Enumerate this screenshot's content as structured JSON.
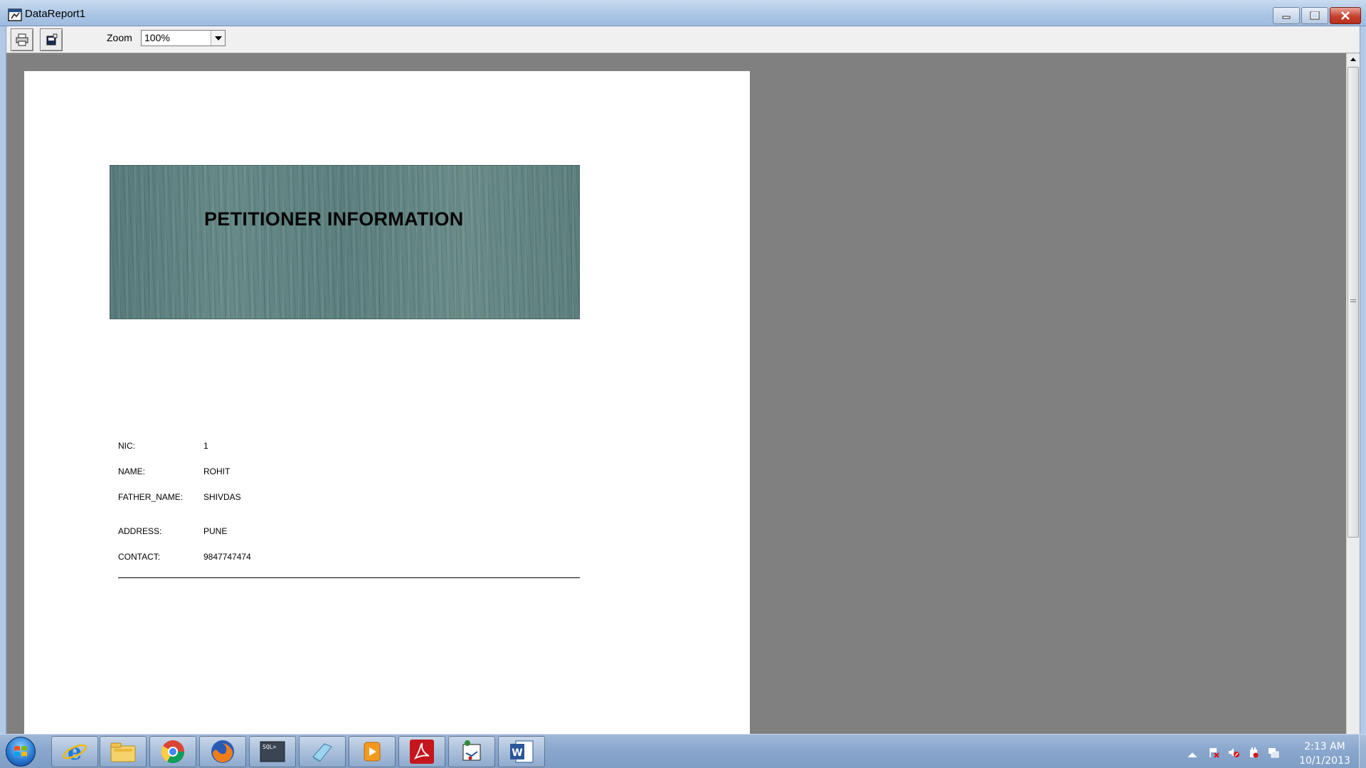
{
  "window": {
    "title": "DataReport1",
    "app_icon": "report-icon",
    "controls": {
      "minimize_icon": "minimize-icon",
      "maximize_icon": "maximize-icon",
      "close_icon": "close-icon"
    }
  },
  "toolbar": {
    "print_icon": "print-icon",
    "export_icon": "export-icon",
    "zoom_label": "Zoom",
    "zoom_value": "100%"
  },
  "report": {
    "title": "PETITIONER INFORMATION",
    "fields": [
      {
        "label": "NIC:",
        "value": "1"
      },
      {
        "label": "NAME:",
        "value": "ROHIT"
      },
      {
        "label": "FATHER_NAME:",
        "value": "SHIVDAS"
      },
      {
        "label": "ADDRESS:",
        "value": "PUNE"
      },
      {
        "label": "CONTACT:",
        "value": "9847747474"
      }
    ]
  },
  "taskbar": {
    "pinned": [
      "internet-explorer-icon",
      "file-explorer-icon",
      "chrome-icon",
      "firefox-icon",
      "sql-plus-icon",
      "notepad-icon",
      "media-player-icon",
      "adobe-reader-icon",
      "vb6-icon",
      "word-icon"
    ],
    "tray_icons": [
      "show-hidden-icons-icon",
      "action-center-icon",
      "volume-muted-icon",
      "power-icon",
      "network-icon"
    ],
    "clock_time": "2:13 AM",
    "clock_date": "10/1/2013"
  },
  "colors": {
    "preview_background": "#808080",
    "banner": "#5f8281",
    "taskbar": "#8aa7cd",
    "close_button": "#c8412e"
  }
}
